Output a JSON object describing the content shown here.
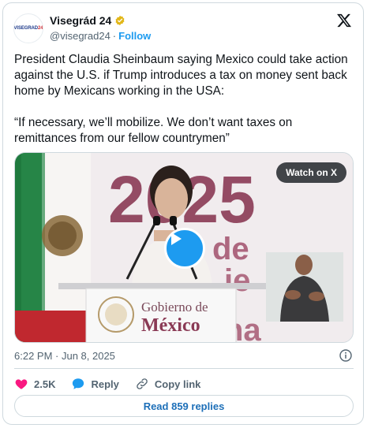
{
  "author": {
    "display_name": "Visegrád 24",
    "handle": "@visegrad24",
    "avatar_text_a": "VISEGRAD",
    "avatar_text_b": "24",
    "verified_badge_icon": "gold-verified-badge-icon",
    "badge_color": "#e2b719"
  },
  "header": {
    "separator": "·",
    "follow_label": "Follow",
    "logo_icon": "x-logo-icon"
  },
  "tweet": {
    "paragraph_1": "President Claudia Sheinbaum saying Mexico could take action against the U.S. if Trump introduces a tax on money sent back home by Mexicans working in the USA:",
    "paragraph_2": "“If necessary, we’ll mobilize. We don’t want taxes on remittances from our fellow countrymen”"
  },
  "media": {
    "watch_label": "Watch on X",
    "play_icon": "play-icon",
    "backdrop_year": "2025",
    "backdrop_text_de": "de",
    "backdrop_text_je": "je",
    "backdrop_text_na": "na",
    "podium_line_1": "Gobierno de",
    "podium_line_2": "México"
  },
  "meta": {
    "timestamp": "6:22 PM · Jun 8, 2025",
    "info_icon": "info-icon"
  },
  "actions": {
    "like_count": "2.5K",
    "reply_label": "Reply",
    "copy_link_label": "Copy link",
    "like_color": "#f91880",
    "reply_color": "#1d9bf0"
  },
  "footer": {
    "read_replies_label": "Read 859 replies"
  },
  "colors": {
    "accent": "#1d9bf0",
    "text": "#0f1419",
    "muted": "#536471",
    "border": "#cfd9de"
  }
}
